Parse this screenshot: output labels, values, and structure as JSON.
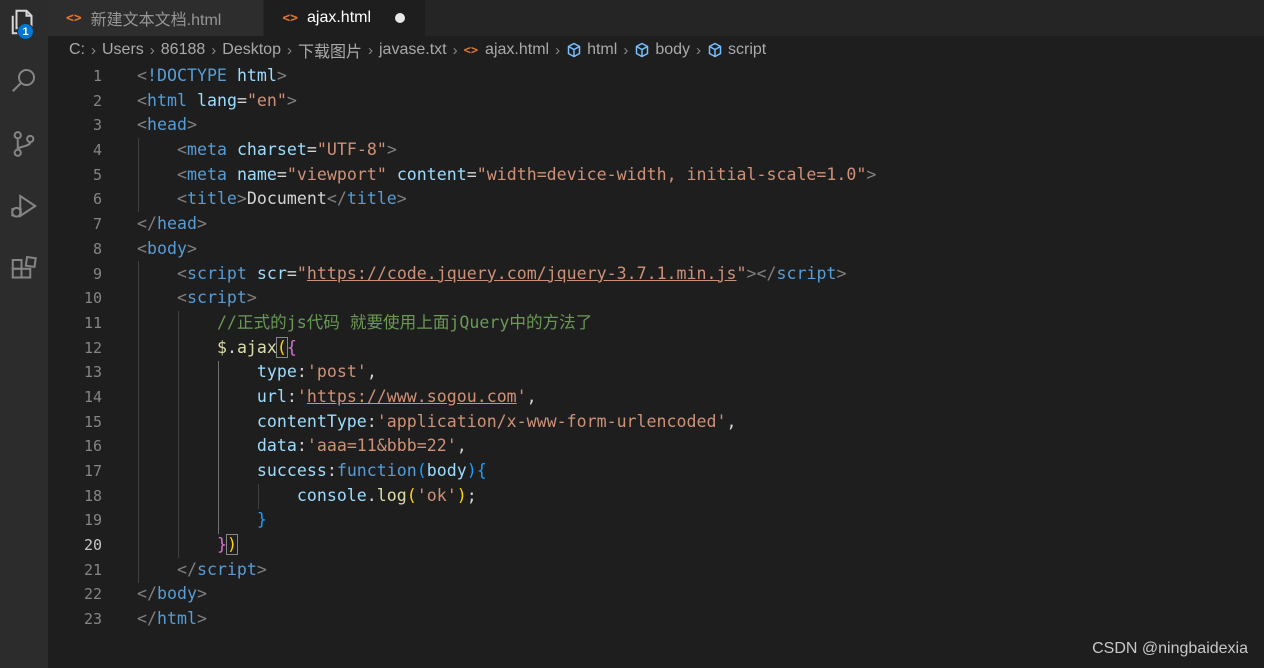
{
  "activity": {
    "badge": "1",
    "icons": [
      "files-icon",
      "search-icon",
      "source-control-icon",
      "run-debug-icon",
      "extensions-icon"
    ]
  },
  "tabs": [
    {
      "label": "新建文本文档.html",
      "active": false
    },
    {
      "label": "ajax.html",
      "active": true,
      "dirty": true
    }
  ],
  "breadcrumb": [
    "C:",
    "Users",
    "86188",
    "Desktop",
    "下载图片",
    "javase.txt",
    "ajax.html",
    "html",
    "body",
    "script"
  ],
  "editor": {
    "line_numbers": [
      "1",
      "2",
      "3",
      "4",
      "5",
      "6",
      "7",
      "8",
      "9",
      "10",
      "11",
      "12",
      "13",
      "14",
      "15",
      "16",
      "17",
      "18",
      "19",
      "20",
      "21",
      "22",
      "23"
    ],
    "current_line": 20,
    "lines": [
      [
        [
          "t-br",
          "<"
        ],
        [
          "t-tag",
          "!DOCTYPE"
        ],
        [
          "t-pl",
          " "
        ],
        [
          "t-attr",
          "html"
        ],
        [
          "t-br",
          ">"
        ]
      ],
      [
        [
          "t-br",
          "<"
        ],
        [
          "t-tag",
          "html"
        ],
        [
          "t-pl",
          " "
        ],
        [
          "t-attr",
          "lang"
        ],
        [
          "t-pl",
          "="
        ],
        [
          "t-str",
          "\"en\""
        ],
        [
          "t-br",
          ">"
        ]
      ],
      [
        [
          "t-br",
          "<"
        ],
        [
          "t-tag",
          "head"
        ],
        [
          "t-br",
          ">"
        ]
      ],
      [
        [
          "t-pl",
          "    "
        ],
        [
          "t-br",
          "<"
        ],
        [
          "t-tag",
          "meta"
        ],
        [
          "t-pl",
          " "
        ],
        [
          "t-attr",
          "charset"
        ],
        [
          "t-pl",
          "="
        ],
        [
          "t-str",
          "\"UTF-8\""
        ],
        [
          "t-br",
          ">"
        ]
      ],
      [
        [
          "t-pl",
          "    "
        ],
        [
          "t-br",
          "<"
        ],
        [
          "t-tag",
          "meta"
        ],
        [
          "t-pl",
          " "
        ],
        [
          "t-attr",
          "name"
        ],
        [
          "t-pl",
          "="
        ],
        [
          "t-str",
          "\"viewport\""
        ],
        [
          "t-pl",
          " "
        ],
        [
          "t-attr",
          "content"
        ],
        [
          "t-pl",
          "="
        ],
        [
          "t-str",
          "\"width=device-width, initial-scale=1.0\""
        ],
        [
          "t-br",
          ">"
        ]
      ],
      [
        [
          "t-pl",
          "    "
        ],
        [
          "t-br",
          "<"
        ],
        [
          "t-tag",
          "title"
        ],
        [
          "t-br",
          ">"
        ],
        [
          "t-pl",
          "Document"
        ],
        [
          "t-br",
          "</"
        ],
        [
          "t-tag",
          "title"
        ],
        [
          "t-br",
          ">"
        ]
      ],
      [
        [
          "t-br",
          "</"
        ],
        [
          "t-tag",
          "head"
        ],
        [
          "t-br",
          ">"
        ]
      ],
      [
        [
          "t-br",
          "<"
        ],
        [
          "t-tag",
          "body"
        ],
        [
          "t-br",
          ">"
        ]
      ],
      [
        [
          "t-pl",
          "    "
        ],
        [
          "t-br",
          "<"
        ],
        [
          "t-tag",
          "script"
        ],
        [
          "t-pl",
          " "
        ],
        [
          "t-attr",
          "scr"
        ],
        [
          "t-pl",
          "="
        ],
        [
          "t-str",
          "\""
        ],
        [
          "t-str u",
          "https://code.jquery.com/jquery-3.7.1.min.js"
        ],
        [
          "t-str",
          "\""
        ],
        [
          "t-br",
          "></"
        ],
        [
          "t-tag",
          "script"
        ],
        [
          "t-br",
          ">"
        ]
      ],
      [
        [
          "t-pl",
          "    "
        ],
        [
          "t-br",
          "<"
        ],
        [
          "t-tag",
          "script"
        ],
        [
          "t-br",
          ">"
        ]
      ],
      [
        [
          "t-pl",
          "        "
        ],
        [
          "t-cmt",
          "//正式的js代码 就要使用上面jQuery中的方法了"
        ]
      ],
      [
        [
          "t-pl",
          "        "
        ],
        [
          "t-fn",
          "$"
        ],
        [
          "t-pl",
          "."
        ],
        [
          "t-fn",
          "ajax"
        ],
        [
          "t-p1 pbox",
          "("
        ],
        [
          "t-p2",
          "{"
        ]
      ],
      [
        [
          "t-pl",
          "            "
        ],
        [
          "t-attr",
          "type"
        ],
        [
          "t-pl",
          ":"
        ],
        [
          "t-str",
          "'post'"
        ],
        [
          "t-pl",
          ","
        ]
      ],
      [
        [
          "t-pl",
          "            "
        ],
        [
          "t-attr",
          "url"
        ],
        [
          "t-pl",
          ":"
        ],
        [
          "t-str",
          "'"
        ],
        [
          "t-str u",
          "https://www.sogou.com"
        ],
        [
          "t-str",
          "'"
        ],
        [
          "t-pl",
          ","
        ]
      ],
      [
        [
          "t-pl",
          "            "
        ],
        [
          "t-attr",
          "contentType"
        ],
        [
          "t-pl",
          ":"
        ],
        [
          "t-str",
          "'application/x-www-form-urlencoded'"
        ],
        [
          "t-pl",
          ","
        ]
      ],
      [
        [
          "t-pl",
          "            "
        ],
        [
          "t-attr",
          "data"
        ],
        [
          "t-pl",
          ":"
        ],
        [
          "t-str",
          "'aaa=11&bbb=22'"
        ],
        [
          "t-pl",
          ","
        ]
      ],
      [
        [
          "t-pl",
          "            "
        ],
        [
          "t-attr",
          "success"
        ],
        [
          "t-pl",
          ":"
        ],
        [
          "t-kw",
          "function"
        ],
        [
          "t-p3",
          "("
        ],
        [
          "t-attr",
          "body"
        ],
        [
          "t-p3",
          ")"
        ],
        [
          "t-p3",
          "{"
        ]
      ],
      [
        [
          "t-pl",
          "                "
        ],
        [
          "t-attr",
          "console"
        ],
        [
          "t-pl",
          "."
        ],
        [
          "t-fn",
          "log"
        ],
        [
          "t-p1",
          "("
        ],
        [
          "t-str",
          "'ok'"
        ],
        [
          "t-p1",
          ")"
        ],
        [
          "t-pl",
          ";"
        ]
      ],
      [
        [
          "t-pl",
          "            "
        ],
        [
          "t-p3",
          "}"
        ]
      ],
      [
        [
          "t-pl",
          "        "
        ],
        [
          "t-p2",
          "}"
        ],
        [
          "t-p1 pbox",
          ")"
        ]
      ],
      [
        [
          "t-pl",
          "    "
        ],
        [
          "t-br",
          "</"
        ],
        [
          "t-tag",
          "script"
        ],
        [
          "t-br",
          ">"
        ]
      ],
      [
        [
          "t-br",
          "</"
        ],
        [
          "t-tag",
          "body"
        ],
        [
          "t-br",
          ">"
        ]
      ],
      [
        [
          "t-br",
          "</"
        ],
        [
          "t-tag",
          "html"
        ],
        [
          "t-br",
          ">"
        ]
      ]
    ]
  },
  "watermark": "CSDN @ningbaidexia"
}
